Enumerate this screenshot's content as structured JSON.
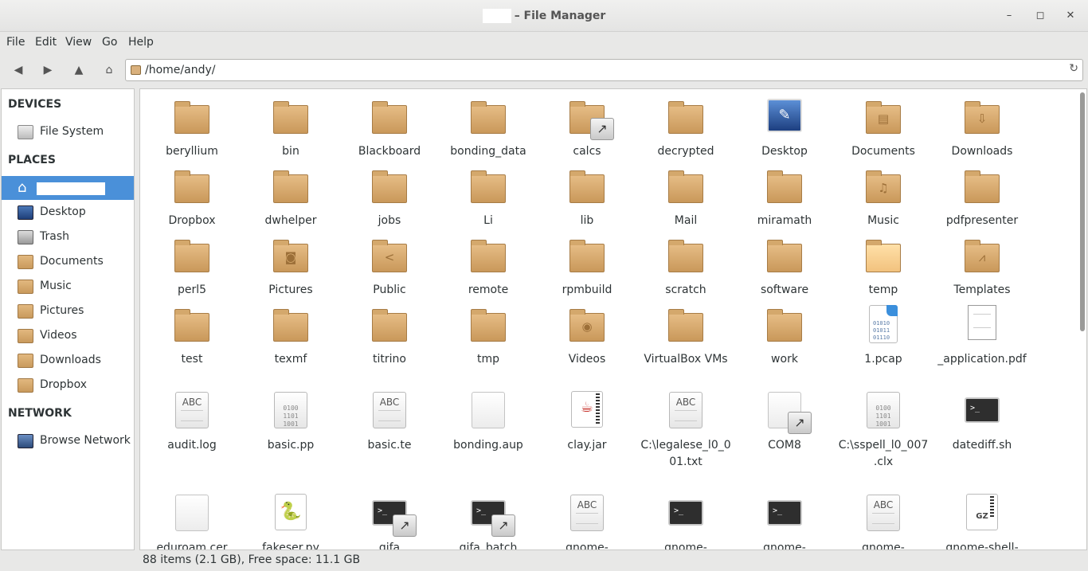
{
  "window": {
    "title": "– File Manager",
    "minimize": "–",
    "maximize": "◻",
    "close": "✕"
  },
  "menu": [
    "File",
    "Edit",
    "View",
    "Go",
    "Help"
  ],
  "location": {
    "path": "/home/andy/"
  },
  "sidebar": {
    "devices_heading": "DEVICES",
    "devices": [
      {
        "label": "File System",
        "icon": "drive-icon"
      }
    ],
    "places_heading": "PLACES",
    "places": [
      {
        "label": "",
        "icon": "home-icon",
        "selected": true
      },
      {
        "label": "Desktop",
        "icon": "desktop-icon"
      },
      {
        "label": "Trash",
        "icon": "trash-icon"
      },
      {
        "label": "Documents",
        "icon": "folder-icon"
      },
      {
        "label": "Music",
        "icon": "folder-icon"
      },
      {
        "label": "Pictures",
        "icon": "folder-icon"
      },
      {
        "label": "Videos",
        "icon": "folder-icon"
      },
      {
        "label": "Downloads",
        "icon": "folder-icon"
      },
      {
        "label": "Dropbox",
        "icon": "folder-icon"
      }
    ],
    "network_heading": "NETWORK",
    "network": [
      {
        "label": "Browse Network",
        "icon": "network-icon"
      }
    ]
  },
  "files": [
    {
      "name": "beryllium",
      "type": "folder"
    },
    {
      "name": "bin",
      "type": "folder"
    },
    {
      "name": "Blackboard",
      "type": "folder"
    },
    {
      "name": "bonding_data",
      "type": "folder"
    },
    {
      "name": "calcs",
      "type": "folder",
      "link": true
    },
    {
      "name": "decrypted",
      "type": "folder"
    },
    {
      "name": "Desktop",
      "type": "desktop"
    },
    {
      "name": "Documents",
      "type": "folder",
      "glyph": "▤"
    },
    {
      "name": "Downloads",
      "type": "folder",
      "glyph": "⇩"
    },
    {
      "name": "Dropbox",
      "type": "folder"
    },
    {
      "name": "dwhelper",
      "type": "folder"
    },
    {
      "name": "jobs",
      "type": "folder"
    },
    {
      "name": "Li",
      "type": "folder"
    },
    {
      "name": "lib",
      "type": "folder"
    },
    {
      "name": "Mail",
      "type": "folder"
    },
    {
      "name": "miramath",
      "type": "folder"
    },
    {
      "name": "Music",
      "type": "folder",
      "glyph": "♫"
    },
    {
      "name": "pdfpresenter",
      "type": "folder"
    },
    {
      "name": "perl5",
      "type": "folder"
    },
    {
      "name": "Pictures",
      "type": "folder",
      "glyph": "◙"
    },
    {
      "name": "Public",
      "type": "folder",
      "glyph": "<"
    },
    {
      "name": "remote",
      "type": "folder"
    },
    {
      "name": "rpmbuild",
      "type": "folder"
    },
    {
      "name": "scratch",
      "type": "folder"
    },
    {
      "name": "software",
      "type": "folder"
    },
    {
      "name": "temp",
      "type": "folder-light"
    },
    {
      "name": "Templates",
      "type": "folder",
      "glyph": "⩘"
    },
    {
      "name": "test",
      "type": "folder"
    },
    {
      "name": "texmf",
      "type": "folder"
    },
    {
      "name": "titrino",
      "type": "folder"
    },
    {
      "name": "tmp",
      "type": "folder"
    },
    {
      "name": "Videos",
      "type": "folder",
      "glyph": "◉"
    },
    {
      "name": "VirtualBox VMs",
      "type": "folder"
    },
    {
      "name": "work",
      "type": "folder"
    },
    {
      "name": "1.pcap",
      "type": "pcap"
    },
    {
      "name": "_application.pdf",
      "type": "pdf"
    },
    {
      "name": "audit.log",
      "type": "text"
    },
    {
      "name": "basic.pp",
      "type": "binary"
    },
    {
      "name": "basic.te",
      "type": "text"
    },
    {
      "name": "bonding.aup",
      "type": "blank"
    },
    {
      "name": "clay.jar",
      "type": "jar"
    },
    {
      "name": "C:\\legalese_l0_001.txt",
      "type": "text"
    },
    {
      "name": "COM8",
      "type": "blank",
      "link": true
    },
    {
      "name": "C:\\sspell_l0_007.clx",
      "type": "binary"
    },
    {
      "name": "datediff.sh",
      "type": "script"
    },
    {
      "name": "eduroam.cer",
      "type": "blank"
    },
    {
      "name": "fakeser.py",
      "type": "python"
    },
    {
      "name": "gifa",
      "type": "script",
      "link": true
    },
    {
      "name": "gifa_batch",
      "type": "script",
      "link": true
    },
    {
      "name": "gnome-",
      "type": "text"
    },
    {
      "name": "gnome-",
      "type": "script"
    },
    {
      "name": "gnome-",
      "type": "script"
    },
    {
      "name": "gnome-",
      "type": "text"
    },
    {
      "name": "gnome-shell-",
      "type": "gz"
    }
  ],
  "status": {
    "text": "88 items (2.1 GB), Free space: 11.1 GB"
  },
  "colors": {
    "selection": "#4a90d9",
    "folder": "#d4a86c"
  }
}
